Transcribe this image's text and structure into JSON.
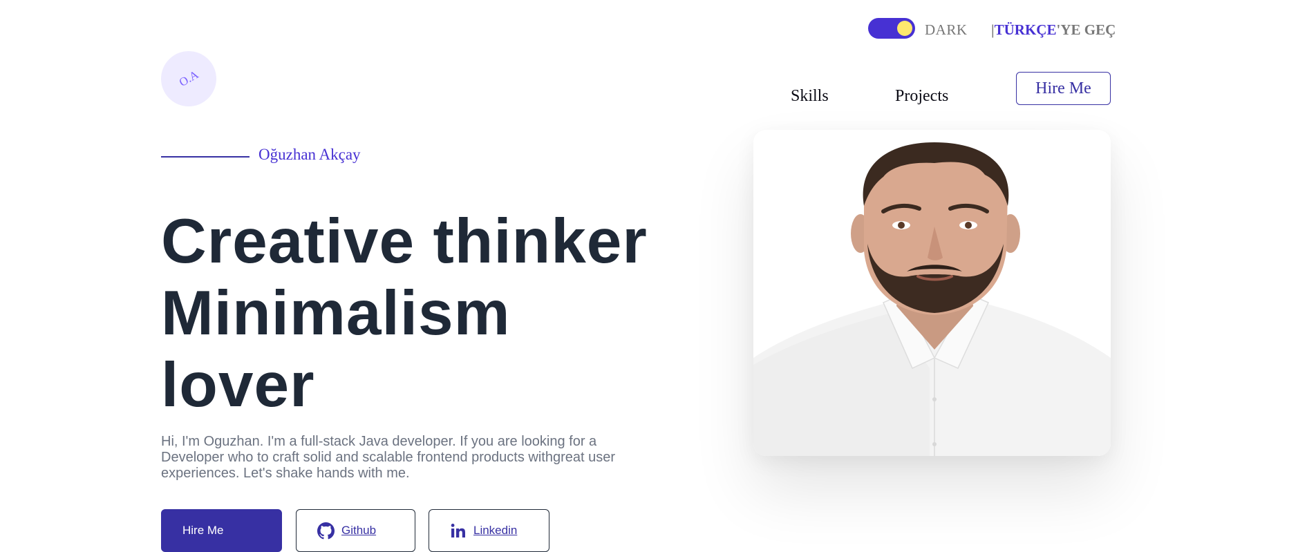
{
  "header": {
    "theme_toggle_label": "DARK",
    "language_link": {
      "prefix": "|",
      "accent": "TÜRKÇE",
      "suffix": "'YE GEÇ"
    }
  },
  "logo": {
    "initials": "O.A"
  },
  "nav": {
    "skills": "Skills",
    "projects": "Projects",
    "hire_me": "Hire Me"
  },
  "hero": {
    "name": "Oğuzhan Akçay",
    "headline_lines": [
      "Creative thinker",
      "Minimalism",
      "lover"
    ],
    "intro": "Hi, I'm Oguzhan. I'm a full-stack Java developer. If you are looking for a Developer who to craft solid and scalable frontend products withgreat user experiences. Let's shake hands with me.",
    "buttons": {
      "hire_me": "Hire Me",
      "github": "Github",
      "linkedin": "Linkedin"
    }
  },
  "icons": {
    "toggle_knob": "sun-dot-icon",
    "github": "github-icon",
    "linkedin": "linkedin-icon"
  },
  "colors": {
    "primary": "#3730a3",
    "accent": "#4731d3",
    "toggle_knob": "#ffe86e",
    "heading": "#1f2937",
    "body_text": "#6b7280",
    "logo_bg": "#eeebff"
  }
}
